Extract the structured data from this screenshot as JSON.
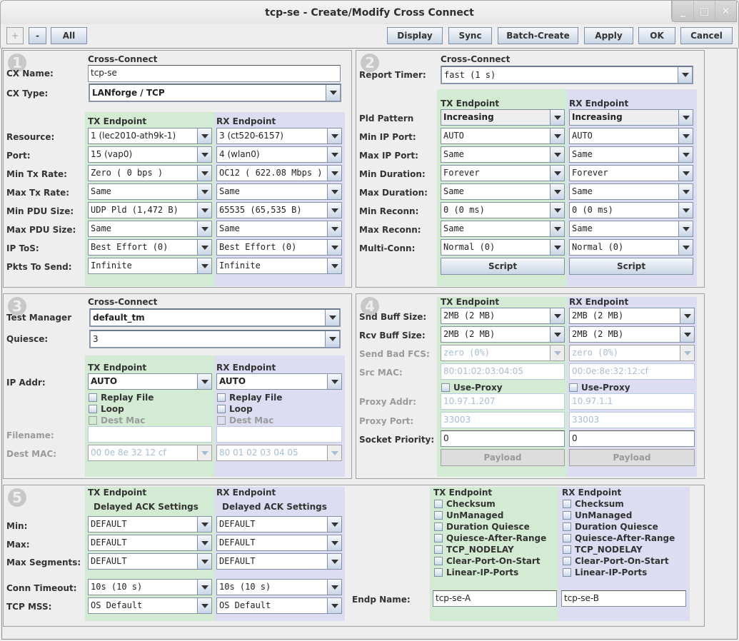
{
  "window": {
    "title": "tcp-se - Create/Modify Cross Connect",
    "controls": {
      "minimize": "_",
      "maximize": "□",
      "close": "✕"
    }
  },
  "toolbar": {
    "plus": "+",
    "minus": "-",
    "all": "All",
    "display": "Display",
    "sync": "Sync",
    "batch_create": "Batch-Create",
    "apply": "Apply",
    "ok": "OK",
    "cancel": "Cancel"
  },
  "headers": {
    "cross_connect": "Cross-Connect",
    "tx": "TX Endpoint",
    "rx": "RX Endpoint",
    "delayed_ack": "Delayed ACK Settings"
  },
  "panel1": {
    "number": "1",
    "cx_name_label": "CX Name:",
    "cx_name": "tcp-se",
    "cx_type_label": "CX Type:",
    "cx_type": "LANforge / TCP",
    "rows": [
      {
        "label": "Resource:",
        "tx": "1 (lec2010-ath9k-1)",
        "rx": "3 (ct520-6157)"
      },
      {
        "label": "Port:",
        "tx": "15 (vap0)",
        "rx": "4 (wlan0)"
      },
      {
        "label": "Min Tx Rate:",
        "tx": "Zero ( 0 bps )",
        "rx": "OC12  ( 622.08 Mbps )"
      },
      {
        "label": "Max Tx Rate:",
        "tx": "Same",
        "rx": "Same"
      },
      {
        "label": "Min PDU Size:",
        "tx": "UDP Pld  (1,472 B)",
        "rx": "65535    (65,535 B)"
      },
      {
        "label": "Max PDU Size:",
        "tx": "Same",
        "rx": "Same"
      },
      {
        "label": "IP ToS:",
        "tx": "Best Effort (0)",
        "rx": "Best Effort (0)"
      },
      {
        "label": "Pkts To Send:",
        "tx": "Infinite",
        "rx": "Infinite"
      }
    ]
  },
  "panel2": {
    "number": "2",
    "report_timer_label": "Report Timer:",
    "report_timer": "fast     (1 s)",
    "rows": [
      {
        "label": "Pld Pattern",
        "tx": "Increasing",
        "rx": "Increasing"
      },
      {
        "label": "Min IP Port:",
        "tx": "AUTO",
        "rx": "AUTO"
      },
      {
        "label": "Max IP Port:",
        "tx": "Same",
        "rx": "Same"
      },
      {
        "label": "Min Duration:",
        "tx": "Forever",
        "rx": "Forever"
      },
      {
        "label": "Max Duration:",
        "tx": "Same",
        "rx": "Same"
      },
      {
        "label": "Min Reconn:",
        "tx": "0     (0 ms)",
        "rx": "0     (0 ms)"
      },
      {
        "label": "Max Reconn:",
        "tx": "Same",
        "rx": "Same"
      },
      {
        "label": "Multi-Conn:",
        "tx": "Normal (0)",
        "rx": "Normal (0)"
      }
    ],
    "script_button": "Script"
  },
  "panel3": {
    "number": "3",
    "test_manager_label": "Test Manager",
    "test_manager": "default_tm",
    "quiesce_label": "Quiesce:",
    "quiesce": "3",
    "ip_addr_label": "IP Addr:",
    "ip_tx": "AUTO",
    "ip_rx": "AUTO",
    "replay_file": "Replay File",
    "loop": "Loop",
    "dest_mac_chk": "Dest Mac",
    "filename_label": "Filename:",
    "filename_tx": "",
    "filename_rx": "",
    "dest_mac_label": "Dest MAC:",
    "dest_mac_tx": "00 0e 8e 32 12 cf",
    "dest_mac_rx": "80 01 02 03 04 05"
  },
  "panel4": {
    "number": "4",
    "snd_buff_label": "Snd Buff Size:",
    "snd_tx": "2MB   (2 MB)",
    "snd_rx": "2MB   (2 MB)",
    "rcv_buff_label": "Rcv Buff Size:",
    "rcv_tx": "2MB   (2 MB)",
    "rcv_rx": "2MB   (2 MB)",
    "bad_fcs_label": "Send Bad FCS:",
    "fcs_tx": "zero (0%)",
    "fcs_rx": "zero (0%)",
    "src_mac_label": "Src MAC:",
    "src_mac_tx": "80:01:02:03:04:05",
    "src_mac_rx": "00:0e:8e:32:12:cf",
    "use_proxy": "Use-Proxy",
    "proxy_addr_label": "Proxy Addr:",
    "proxy_addr_tx": "10.97.1.207",
    "proxy_addr_rx": "10.97.1.1",
    "proxy_port_label": "Proxy Port:",
    "proxy_port_tx": "33003",
    "proxy_port_rx": "33003",
    "socket_prio_label": "Socket Priority:",
    "socket_prio_tx": "0",
    "socket_prio_rx": "0",
    "payload_button": "Payload"
  },
  "panel5": {
    "number": "5",
    "min_label": "Min:",
    "max_label": "Max:",
    "max_seg_label": "Max Segments:",
    "min_tx": "DEFAULT",
    "min_rx": "DEFAULT",
    "max_tx": "DEFAULT",
    "max_rx": "DEFAULT",
    "seg_tx": "DEFAULT",
    "seg_rx": "DEFAULT",
    "conn_timeout_label": "Conn Timeout:",
    "ct_tx": "10s      (10 s)",
    "ct_rx": "10s      (10 s)",
    "tcp_mss_label": "TCP MSS:",
    "mss_tx": "OS Default",
    "mss_rx": "OS Default",
    "checkboxes": [
      "Checksum",
      "UnManaged",
      "Duration Quiesce",
      "Quiesce-After-Range",
      "TCP_NODELAY",
      "Clear-Port-On-Start",
      "Linear-IP-Ports"
    ],
    "endp_name_label": "Endp Name:",
    "endp_tx": "tcp-se-A",
    "endp_rx": "tcp-se-B"
  },
  "colors": {
    "tx_bg": "#d3ebd3",
    "rx_bg": "#dcdcf2",
    "button_gradient_bottom": "#c9d6e6"
  }
}
